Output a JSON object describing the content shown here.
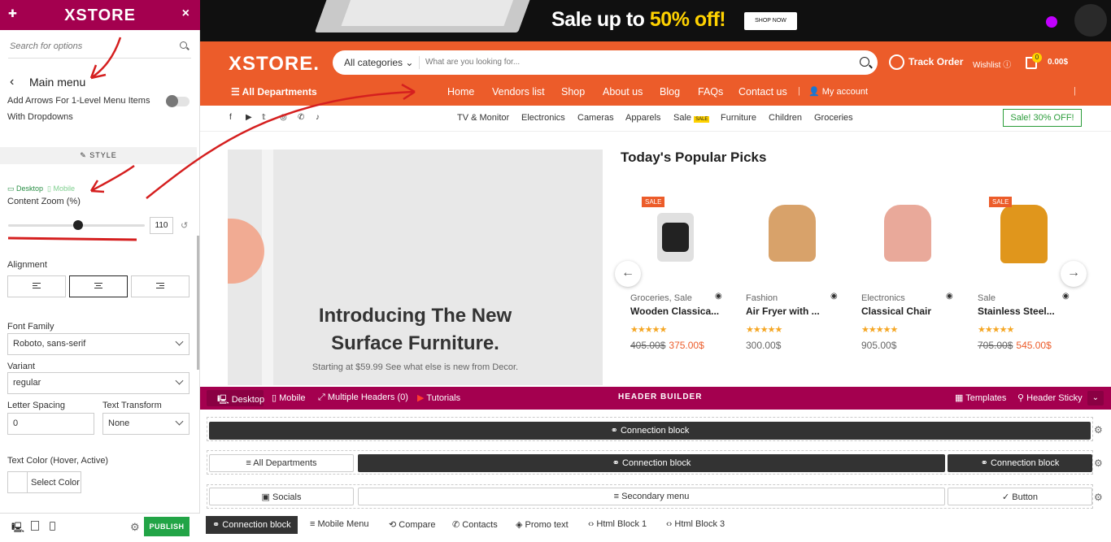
{
  "left_panel": {
    "logo": "XSTORE",
    "close": "×",
    "search_placeholder": "Search for options",
    "back_label": "Main menu",
    "arrows_label_1": "Add Arrows For 1-Level Menu Items",
    "arrows_label_2": "With Dropdowns",
    "style_tab": "STYLE",
    "device_desktop": "Desktop",
    "device_mobile": "Mobile",
    "content_zoom_label": "Content Zoom (%)",
    "content_zoom_value": "110",
    "content_zoom_fraction": 0.51,
    "alignment_label": "Alignment",
    "font_family_label": "Font Family",
    "font_family_value": "Roboto, sans-serif",
    "variant_label": "Variant",
    "variant_value": "regular",
    "letter_spacing_label": "Letter Spacing",
    "letter_spacing_value": "0",
    "text_transform_label": "Text Transform",
    "text_transform_value": "None",
    "text_color_label": "Text Color (Hover, Active)",
    "select_color": "Select Color",
    "publish": "PUBLISH"
  },
  "site": {
    "banner_text": "Sale up to ",
    "banner_highlight": "50% off!",
    "shop_now": "SHOP NOW",
    "logo": "XSTORE.",
    "search_category": "All categories",
    "search_placeholder": "What are you looking for...",
    "track_order": "Track Order",
    "wishlist": "Wishlist",
    "cart_count": "0",
    "cart_total": "0.00$",
    "departments": "All Departments",
    "nav": [
      "Home",
      "Vendors list",
      "Shop",
      "About us",
      "Blog",
      "FAQs",
      "Contact us"
    ],
    "my_account": "My account",
    "categories": [
      "TV & Monitor",
      "Electronics",
      "Cameras",
      "Apparels",
      "Sale",
      "Furniture",
      "Children",
      "Groceries"
    ],
    "sale_tag": "SALE",
    "sale_button": "Sale! 30% OFF!",
    "hero_title_1": "Introducing The New",
    "hero_title_2": "Surface Furniture.",
    "hero_sub": "Starting at $59.99 See what else is new from Decor.",
    "picks_title": "Today's Popular Picks",
    "products": [
      {
        "badge": "SALE",
        "cat": "Groceries, Sale",
        "name": "Wooden Classica...",
        "old": "405.00$",
        "price": "375.00$"
      },
      {
        "badge": "",
        "cat": "Fashion",
        "name": "Air Fryer with ...",
        "old": "",
        "price": "300.00$"
      },
      {
        "badge": "",
        "cat": "Electronics",
        "name": "Classical Chair",
        "old": "",
        "price": "905.00$"
      },
      {
        "badge": "SALE",
        "cat": "Sale",
        "name": "Stainless Steel...",
        "old": "705.00$",
        "price": "545.00$"
      }
    ],
    "stars": "★★★★★"
  },
  "builder": {
    "desktop": "Desktop",
    "mobile": "Mobile",
    "multiple_headers": "Multiple Headers (0)",
    "tutorials": "Tutorials",
    "title": "HEADER BUILDER",
    "templates": "Templates",
    "sticky": "Header Sticky",
    "connection_block": "Connection block",
    "all_departments": "All Departments",
    "socials": "Socials",
    "secondary_menu": "Secondary menu",
    "button": "Button",
    "chips": [
      "Connection block",
      "Mobile Menu",
      "Compare",
      "Contacts",
      "Promo text",
      "Html Block 1",
      "Html Block 3"
    ]
  }
}
